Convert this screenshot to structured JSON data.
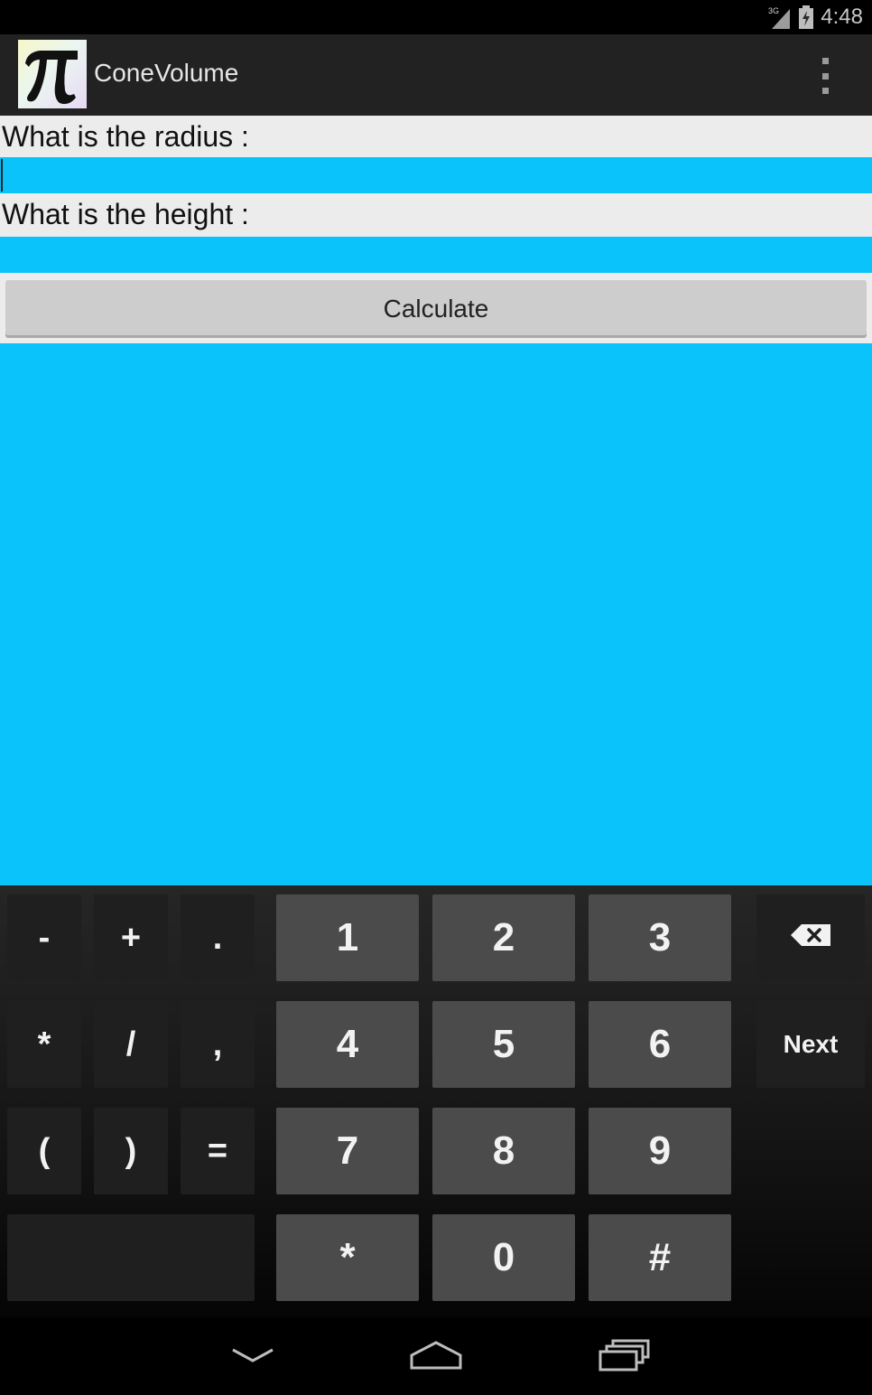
{
  "status_bar": {
    "network": "3G",
    "time": "4:48"
  },
  "action_bar": {
    "title": "ConeVolume",
    "icon": "pi-icon",
    "menu_icon": "overflow-menu-icon"
  },
  "form": {
    "radius_label": "What is the radius :",
    "radius_value": "",
    "height_label": "What is the height :",
    "height_value": "",
    "calculate_label": "Calculate"
  },
  "keyboard": {
    "sym_row1": [
      "-",
      "+",
      "."
    ],
    "sym_row2": [
      "*",
      "/",
      ","
    ],
    "sym_row3": [
      "(",
      ")",
      "="
    ],
    "num_row1": [
      "1",
      "2",
      "3"
    ],
    "num_row2": [
      "4",
      "5",
      "6"
    ],
    "num_row3": [
      "7",
      "8",
      "9"
    ],
    "num_row4": [
      "*",
      "0",
      "#"
    ],
    "next_label": "Next",
    "backspace_icon": "backspace-icon"
  },
  "nav_bar": {
    "buttons": [
      "back-icon",
      "home-icon",
      "recents-icon"
    ]
  },
  "colors": {
    "accent": "#0ac3fb",
    "label_bg": "#ececec",
    "key_num": "#4b4b4b",
    "key_sym": "#1f1f1f"
  }
}
